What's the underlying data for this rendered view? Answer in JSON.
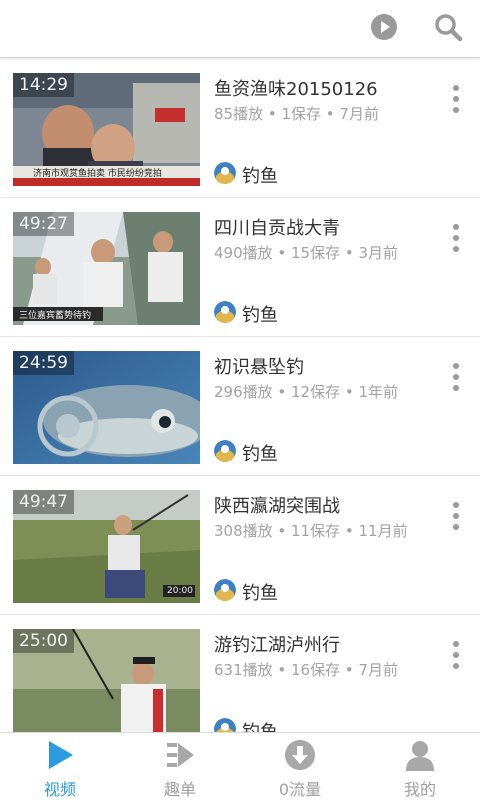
{
  "header": {
    "play_icon": "play-circle-icon",
    "search_icon": "search-icon"
  },
  "videos": [
    {
      "duration": "14:29",
      "title": "鱼资渔味20150126",
      "meta": "85播放 • 1保存 • 7月前",
      "channel": "钓鱼",
      "thumb_overlay_text": "济南市观赏鱼拍卖 市民纷纷竞拍"
    },
    {
      "duration": "49:27",
      "title": "四川自贡战大青",
      "meta": "490播放 • 15保存 • 3月前",
      "channel": "钓鱼",
      "thumb_overlay_text": "三位嘉宾蓄势待钓"
    },
    {
      "duration": "24:59",
      "title": "初识悬坠钓",
      "meta": "296播放 • 12保存 • 1年前",
      "channel": "钓鱼",
      "thumb_overlay_text": ""
    },
    {
      "duration": "49:47",
      "title": "陕西瀛湖突围战",
      "meta": "308播放 • 11保存 • 11月前",
      "channel": "钓鱼",
      "thumb_overlay_text": "20:00"
    },
    {
      "duration": "25:00",
      "title": "游钓江湖泸州行",
      "meta": "631播放 • 16保存 • 7月前",
      "channel": "钓鱼",
      "thumb_overlay_text": ""
    }
  ],
  "tabs": [
    {
      "label": "视频",
      "icon": "play-triangle-icon",
      "active": true
    },
    {
      "label": "趣单",
      "icon": "playlist-icon",
      "active": false
    },
    {
      "label": "0流量",
      "icon": "download-circle-icon",
      "active": false
    },
    {
      "label": "我的",
      "icon": "person-icon",
      "active": false
    }
  ],
  "colors": {
    "accent": "#2b9be0",
    "icon_gray": "#9a9a9a",
    "meta_text": "#a3a3a3",
    "title_text": "#333333"
  }
}
